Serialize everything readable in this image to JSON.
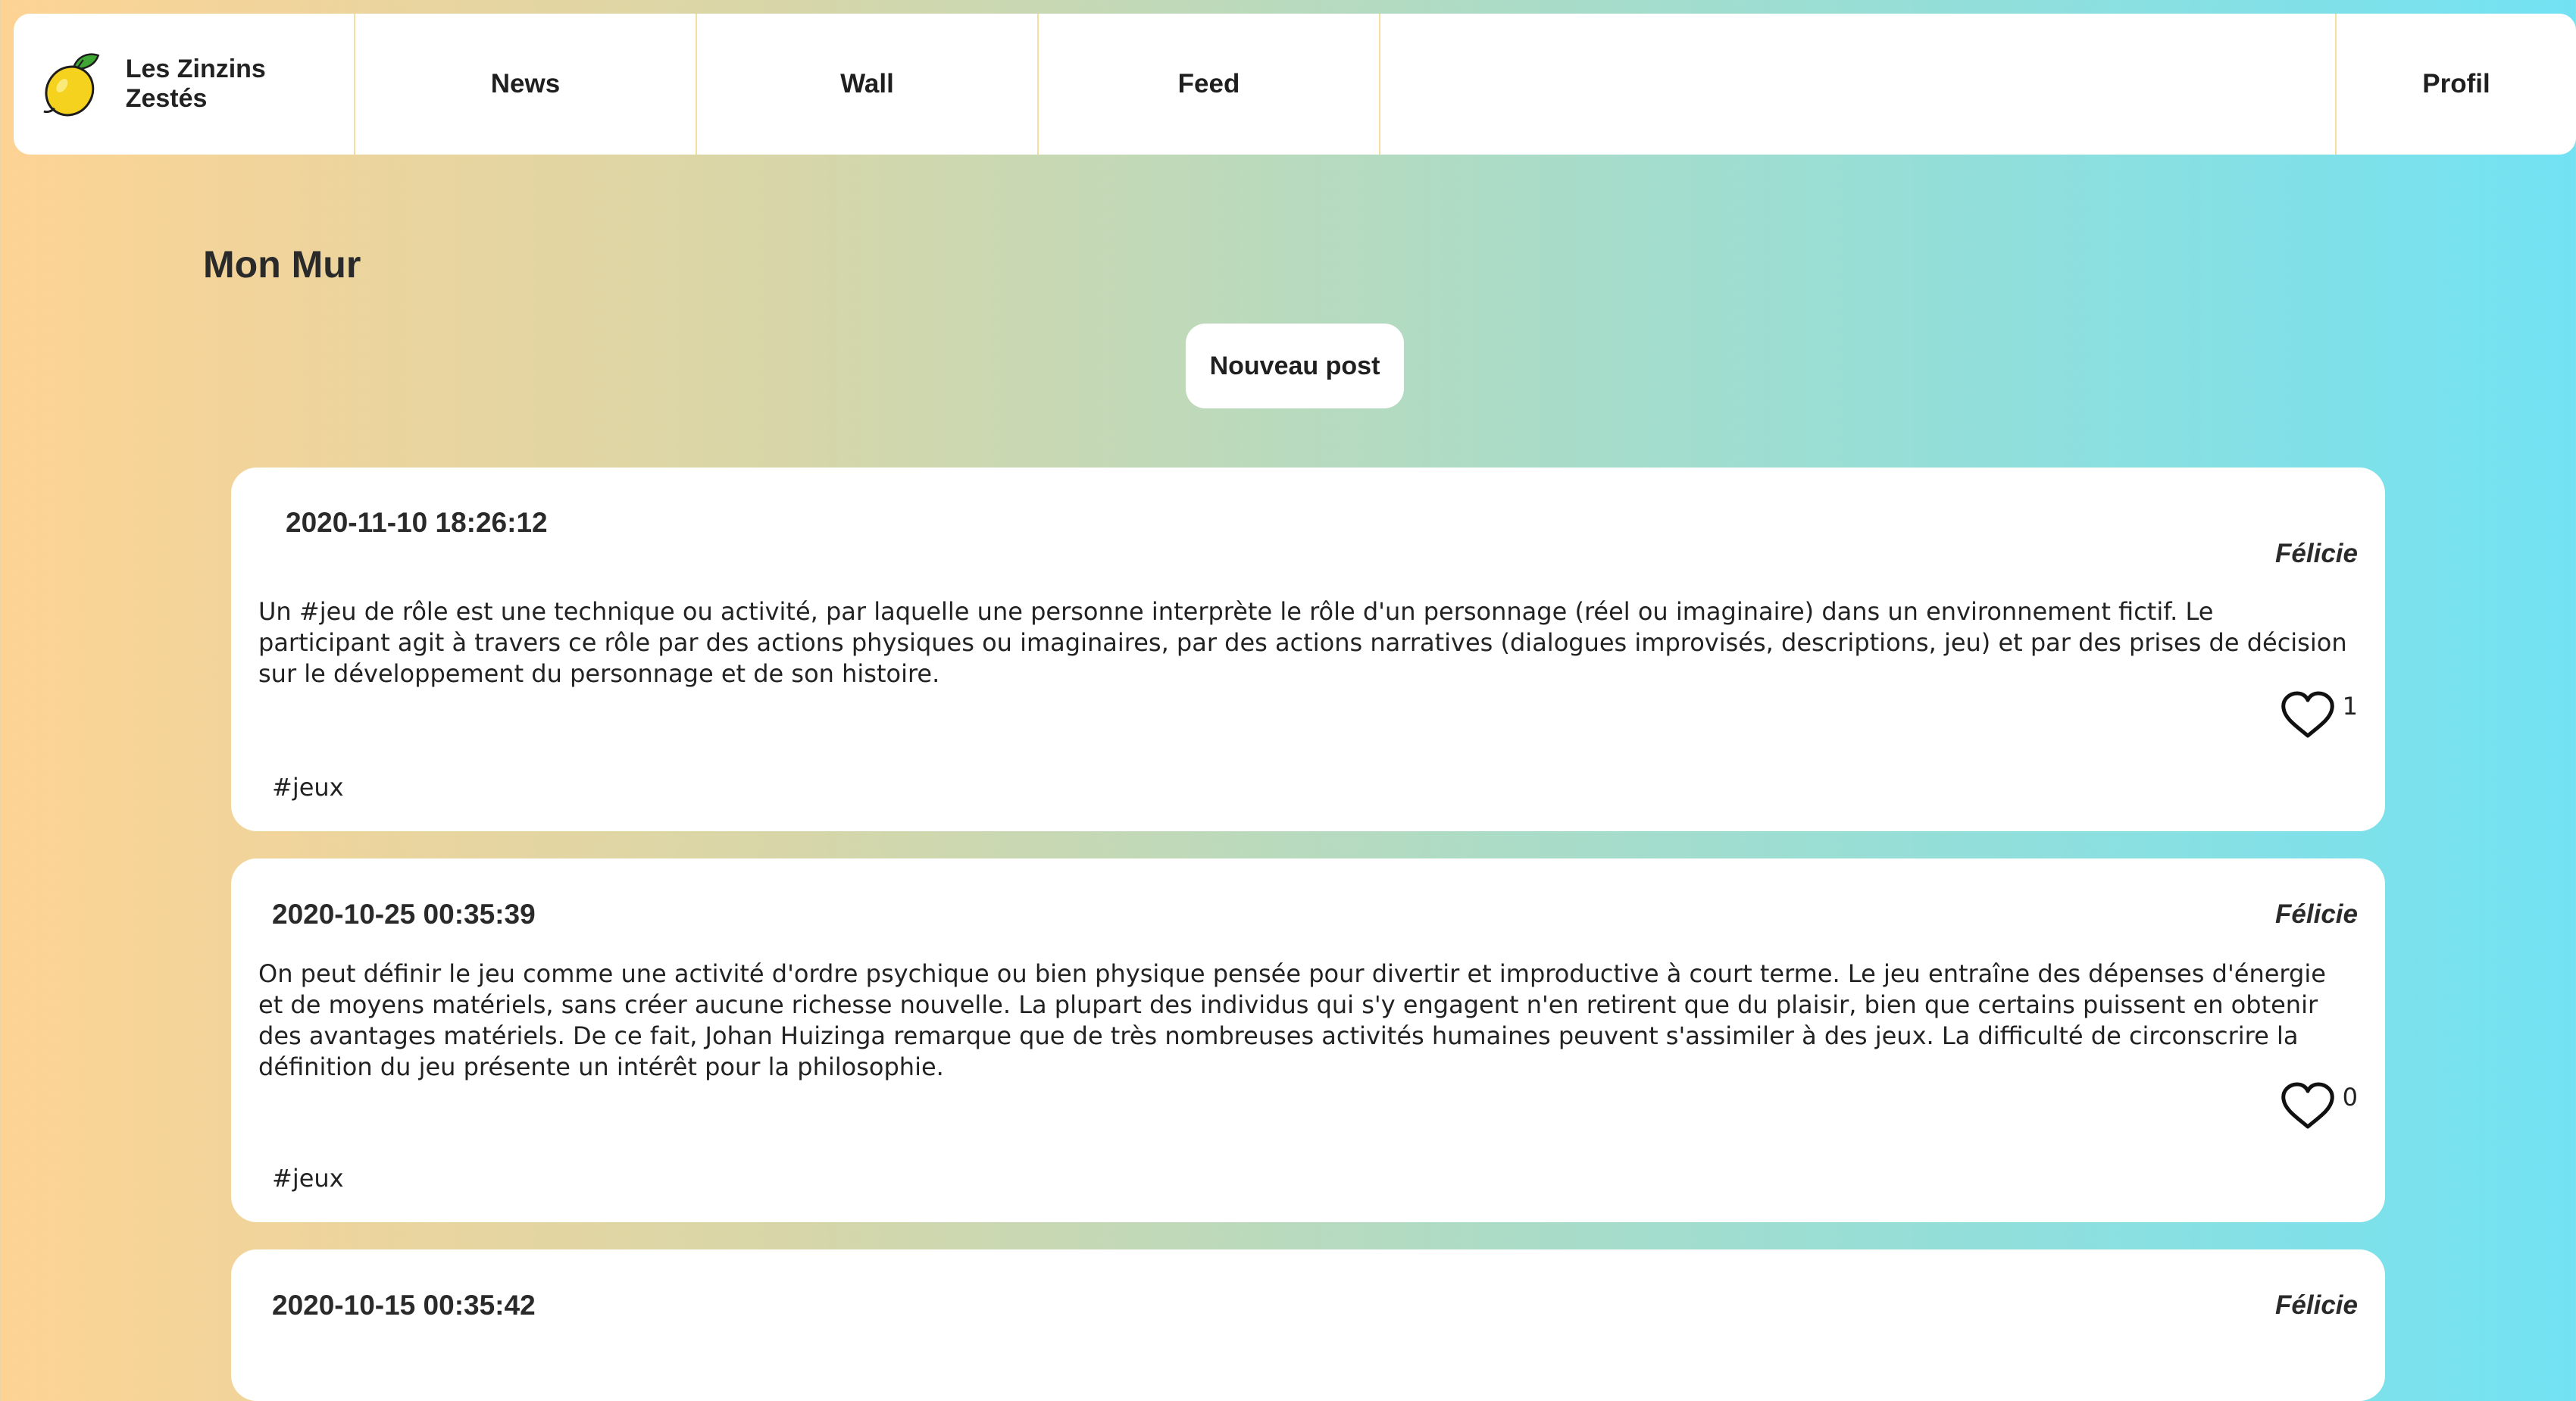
{
  "nav": {
    "brand": "Les Zinzins Zestés",
    "links": [
      "News",
      "Wall",
      "Feed"
    ],
    "profile": "Profil"
  },
  "page": {
    "title": "Mon Mur",
    "new_post_label": "Nouveau post"
  },
  "posts": [
    {
      "date": "2020-11-10 18:26:12",
      "author": "Félicie",
      "content": "Un #jeu de rôle est une technique ou activité, par laquelle une personne interprète le rôle d'un personnage (réel ou imaginaire) dans un environnement fictif. Le participant agit à travers ce rôle par des actions physiques ou imaginaires, par des actions narratives (dialogues improvisés, descriptions, jeu) et par des prises de décision sur le développement du personnage et de son histoire.",
      "likes": "1",
      "tag": "#jeux"
    },
    {
      "date": "2020-10-25 00:35:39",
      "author": "Félicie",
      "content": "On peut définir le jeu comme une activité d'ordre psychique ou bien physique pensée pour divertir et improductive à court terme. Le jeu entraîne des dépenses d'énergie et de moyens matériels, sans créer aucune richesse nouvelle. La plupart des individus qui s'y engagent n'en retirent que du plaisir, bien que certains puissent en obtenir des avantages matériels. De ce fait, Johan Huizinga remarque que de très nombreuses activités humaines peuvent s'assimiler à des jeux. La difficulté de circonscrire la définition du jeu présente un intérêt pour la philosophie.",
      "likes": "0",
      "tag": "#jeux"
    },
    {
      "date": "2020-10-15 00:35:42",
      "author": "Félicie"
    }
  ]
}
